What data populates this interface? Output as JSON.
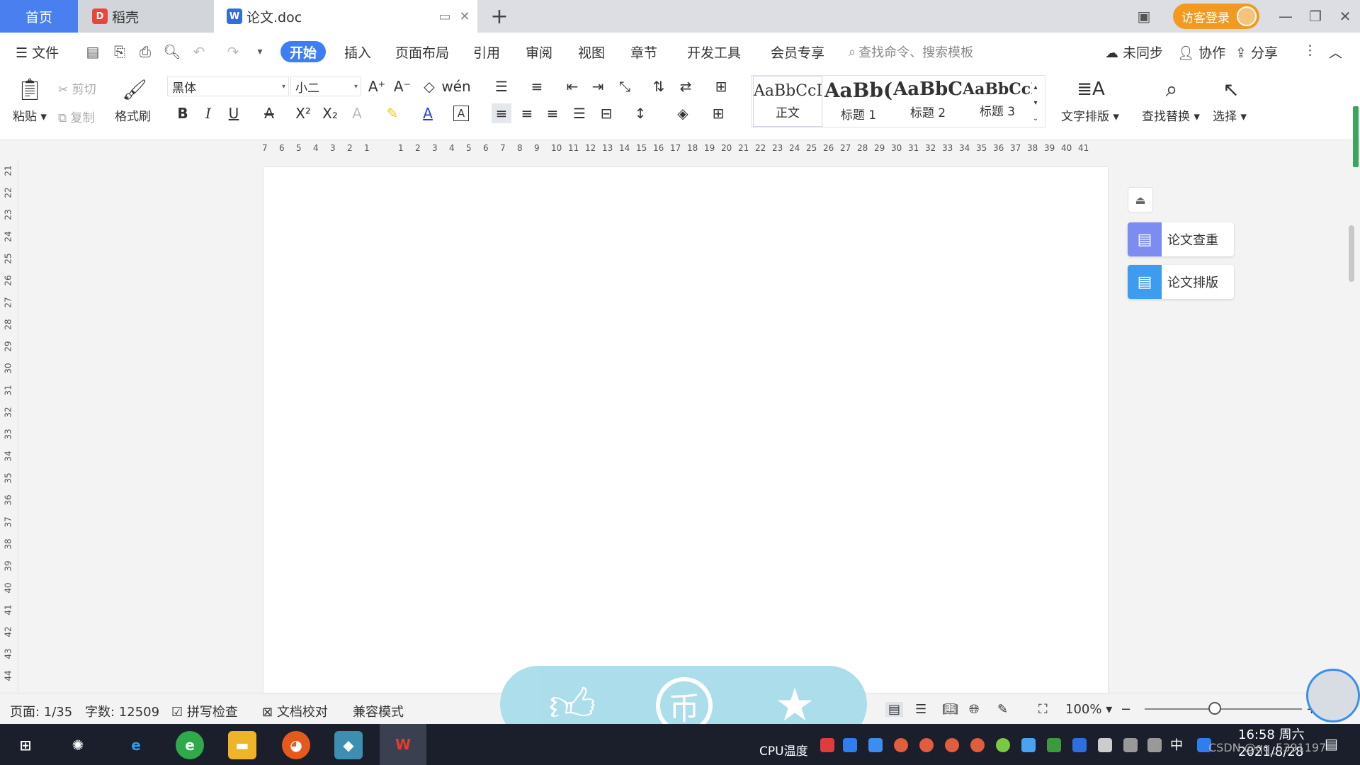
{
  "tabs": {
    "home": "首页",
    "docer": "稻壳",
    "doc": "论文.doc"
  },
  "titlebar": {
    "login": "访客登录"
  },
  "menu": {
    "file": "文件",
    "items": [
      "开始",
      "插入",
      "页面布局",
      "引用",
      "审阅",
      "视图",
      "章节",
      "开发工具",
      "会员专享"
    ],
    "search_placeholder": "查找命令、搜索模板",
    "sync": "未同步",
    "collab": "协作",
    "share": "分享"
  },
  "ribbon": {
    "paste": "粘贴",
    "cut": "剪切",
    "copy": "复制",
    "format_painter": "格式刷",
    "font": "黑体",
    "size": "小二",
    "styles": [
      {
        "sample": "AaBbCcI",
        "name": "正文"
      },
      {
        "sample": "AaBb(",
        "name": "标题 1"
      },
      {
        "sample": "AaBbC",
        "name": "标题 2"
      },
      {
        "sample": "AaBbCcI",
        "name": "标题 3"
      }
    ],
    "text_layout": "文字排版",
    "find_replace": "查找替换",
    "select": "选择"
  },
  "ruler": {
    "h_ticks": [
      "7",
      "6",
      "5",
      "4",
      "3",
      "2",
      "1",
      "",
      "1",
      "2",
      "3",
      "4",
      "5",
      "6",
      "7",
      "8",
      "9",
      "10",
      "11",
      "12",
      "13",
      "14",
      "15",
      "16",
      "17",
      "18",
      "19",
      "20",
      "21",
      "22",
      "23",
      "24",
      "25",
      "26",
      "27",
      "28",
      "29",
      "30",
      "31",
      "32",
      "33",
      "34",
      "35",
      "36",
      "37",
      "38",
      "39",
      "40",
      "41"
    ],
    "v_ticks": [
      "21",
      "22",
      "23",
      "24",
      "25",
      "26",
      "27",
      "28",
      "29",
      "30",
      "31",
      "32",
      "33",
      "34",
      "35",
      "36",
      "37",
      "38",
      "39",
      "40",
      "41",
      "42",
      "43",
      "44"
    ]
  },
  "side_panel": {
    "check": "论文查重",
    "layout": "论文排版"
  },
  "status": {
    "page": "页面: 1/35",
    "words": "字数: 12509",
    "spell": "拼写检查",
    "proof": "文档校对",
    "compat": "兼容模式",
    "zoom": "100%"
  },
  "taskbar": {
    "cpu": "CPU温度",
    "time": "16:58 周六",
    "date": "2021/8/28",
    "watermark": "CSDN @qq_5391197"
  }
}
